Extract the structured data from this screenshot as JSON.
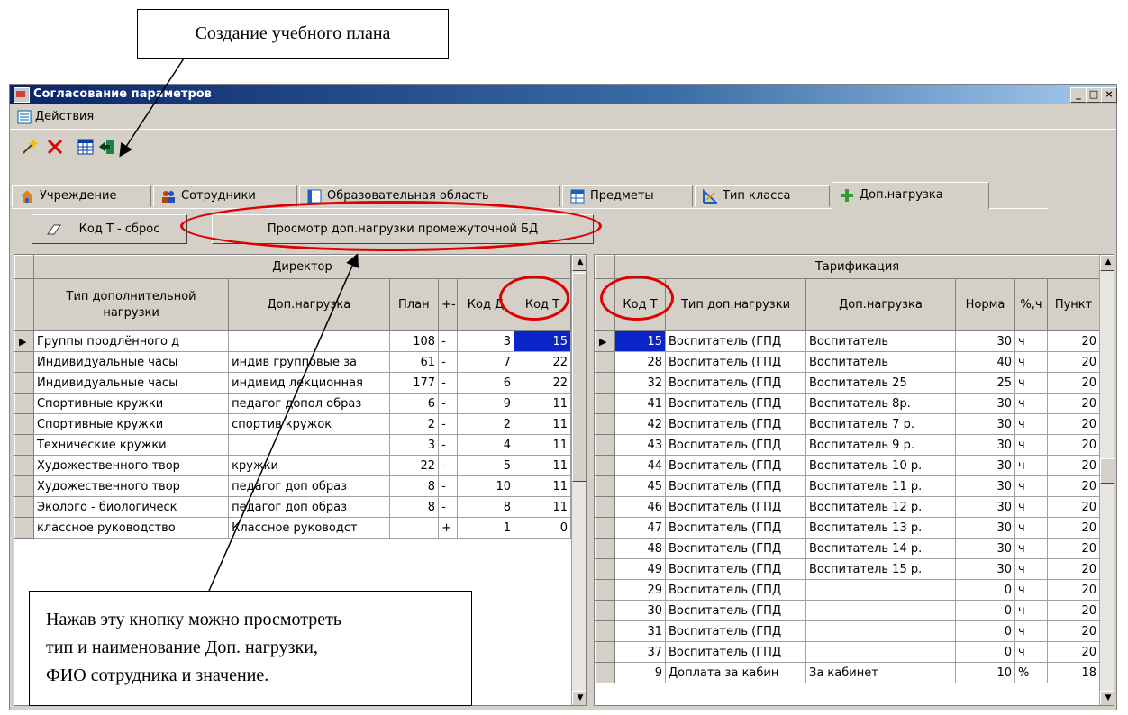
{
  "callouts": {
    "top": "Создание учебного плана",
    "bottom_lines": [
      "Нажав эту кнопку можно просмотреть",
      "тип и наименование Доп. нагрузки,",
      "ФИО сотрудника и значение."
    ]
  },
  "window": {
    "title": "Согласование параметров",
    "controls": [
      "_",
      "□",
      "×"
    ]
  },
  "menu": {
    "actions": "Действия"
  },
  "toolbar": {
    "icons": [
      "wand-icon",
      "delete-icon",
      "table-icon",
      "exit-icon"
    ]
  },
  "tabs": [
    {
      "label": "Учреждение",
      "icon": "building-icon"
    },
    {
      "label": "Сотрудники",
      "icon": "people-icon"
    },
    {
      "label": "Образовательная область",
      "icon": "grid-icon"
    },
    {
      "label": "Предметы",
      "icon": "table-icon"
    },
    {
      "label": "Тип класса",
      "icon": "ruler-icon"
    },
    {
      "label": "Доп.нагрузка",
      "icon": "plus-icon",
      "active": true
    }
  ],
  "buttons": {
    "reset": "Код Т - сброс",
    "view": "Просмотр доп.нагрузки промежуточной БД"
  },
  "left_grid": {
    "group_header": "Директор",
    "columns": [
      "Тип дополнительной нагрузки",
      "Доп.нагрузка",
      "План",
      "+-",
      "Код Д",
      "Код Т"
    ],
    "rows": [
      [
        "Группы продлённого д",
        "",
        "108",
        "-",
        "3",
        "15"
      ],
      [
        "Индивидуальные часы",
        "индив групповые за",
        "61",
        "-",
        "7",
        "22"
      ],
      [
        "Индивидуальные часы",
        "индивид лекционная",
        "177",
        "-",
        "6",
        "22"
      ],
      [
        "Спортивные кружки",
        "педагог допол образ",
        "6",
        "-",
        "9",
        "11"
      ],
      [
        "Спортивные кружки",
        "спортив кружок",
        "2",
        "-",
        "2",
        "11"
      ],
      [
        "Технические кружки",
        "",
        "3",
        "-",
        "4",
        "11"
      ],
      [
        "Художественного твор",
        "кружки",
        "22",
        "-",
        "5",
        "11"
      ],
      [
        "Художественного твор",
        "педагог доп образ",
        "8",
        "-",
        "10",
        "11"
      ],
      [
        "Эколого - биологическ",
        "педагог доп образ",
        "8",
        "-",
        "8",
        "11"
      ],
      [
        "классное руководство",
        "Классное руководст",
        "",
        "+",
        "1",
        "0"
      ]
    ]
  },
  "right_grid": {
    "group_header": "Тарификация",
    "columns": [
      "Код Т",
      "Тип доп.нагрузки",
      "Доп.нагрузка",
      "Норма",
      "%,ч",
      "Пункт"
    ],
    "rows": [
      [
        "15",
        "Воспитатель (ГПД",
        "Воспитатель",
        "30",
        "ч",
        "20"
      ],
      [
        "28",
        "Воспитатель (ГПД",
        "Воспитатель",
        "40",
        "ч",
        "20"
      ],
      [
        "32",
        "Воспитатель (ГПД",
        "Воспитатель 25",
        "25",
        "ч",
        "20"
      ],
      [
        "41",
        "Воспитатель (ГПД",
        "Воспитатель 8р.",
        "30",
        "ч",
        "20"
      ],
      [
        "42",
        "Воспитатель (ГПД",
        "Воспитатель 7 р.",
        "30",
        "ч",
        "20"
      ],
      [
        "43",
        "Воспитатель (ГПД",
        "Воспитатель 9 р.",
        "30",
        "ч",
        "20"
      ],
      [
        "44",
        "Воспитатель (ГПД",
        "Воспитатель 10 р.",
        "30",
        "ч",
        "20"
      ],
      [
        "45",
        "Воспитатель (ГПД",
        "Воспитатель 11 р.",
        "30",
        "ч",
        "20"
      ],
      [
        "46",
        "Воспитатель (ГПД",
        "Воспитатель 12 р.",
        "30",
        "ч",
        "20"
      ],
      [
        "47",
        "Воспитатель (ГПД",
        "Воспитатель 13 р.",
        "30",
        "ч",
        "20"
      ],
      [
        "48",
        "Воспитатель (ГПД",
        "Воспитатель 14 р.",
        "30",
        "ч",
        "20"
      ],
      [
        "49",
        "Воспитатель (ГПД",
        "Воспитатель 15 р.",
        "30",
        "ч",
        "20"
      ],
      [
        "29",
        "Воспитатель (ГПД",
        "",
        "0",
        "ч",
        "20"
      ],
      [
        "30",
        "Воспитатель (ГПД",
        "",
        "0",
        "ч",
        "20"
      ],
      [
        "31",
        "Воспитатель (ГПД",
        "",
        "0",
        "ч",
        "20"
      ],
      [
        "37",
        "Воспитатель (ГПД",
        "",
        "0",
        "ч",
        "20"
      ],
      [
        "9",
        "Доплата за кабин",
        "За кабинет",
        "10",
        "%",
        "18"
      ]
    ]
  },
  "colors": {
    "accent": "#e00000",
    "selection": "#0a24c8",
    "title": "#0a246a"
  }
}
